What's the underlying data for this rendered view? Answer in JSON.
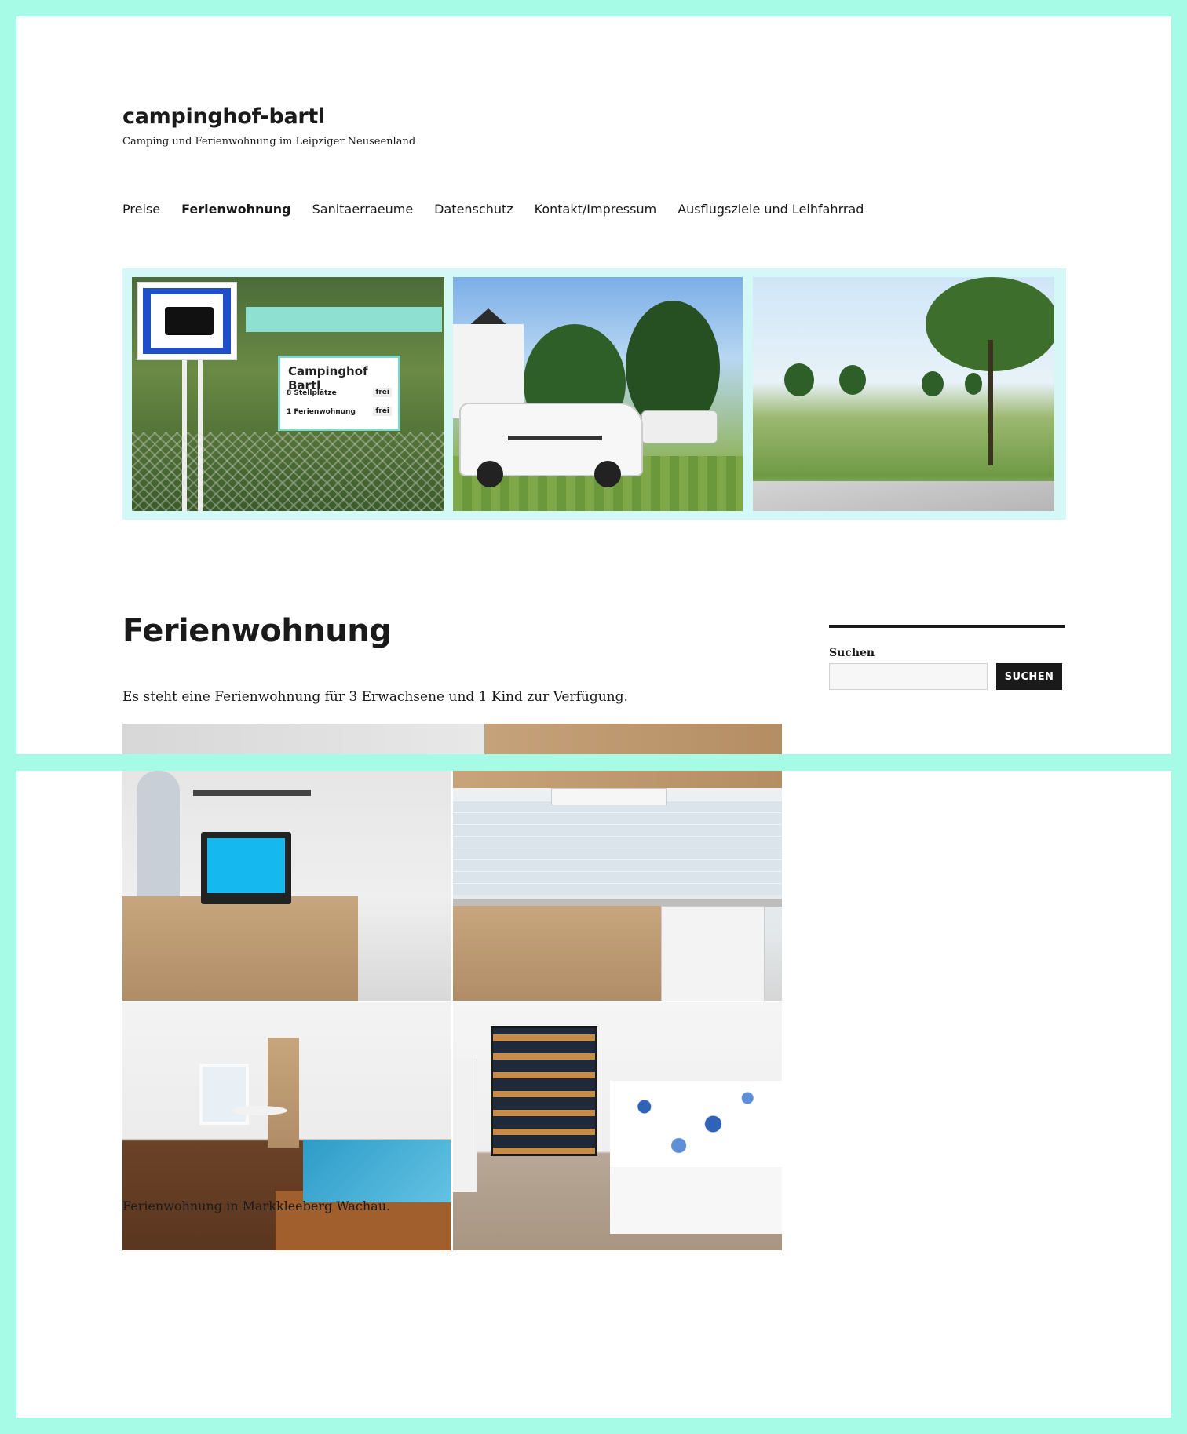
{
  "site": {
    "title": "campinghof-bartl",
    "description": "Camping und Ferienwohnung im Leipziger Neuseenland"
  },
  "nav": {
    "items": [
      {
        "label": "Preise",
        "active": false
      },
      {
        "label": "Ferienwohnung",
        "active": true
      },
      {
        "label": "Sanitaerraeume",
        "active": false
      },
      {
        "label": "Datenschutz",
        "active": false
      },
      {
        "label": "Kontakt/Impressum",
        "active": false
      },
      {
        "label": "Ausflugsziele und Leihfahrrad",
        "active": false
      }
    ]
  },
  "header_sign": {
    "title": "Campinghof Bartl",
    "rows": [
      {
        "label": "8 Stellplätze",
        "badge": "frei"
      },
      {
        "label": "1 Ferienwohnung",
        "badge": "frei"
      }
    ]
  },
  "page": {
    "title": "Ferienwohnung",
    "intro": "Es steht eine Ferienwohnung für 3 Erwachsene und 1 Kind zur Verfügung.",
    "caption": "Ferienwohnung in Markkleeberg Wachau."
  },
  "sidebar": {
    "search_label": "Suchen",
    "search_value": "",
    "search_button": "SUCHEN"
  },
  "colors": {
    "frame": "#a5fbe6",
    "header_bg": "#d4f8f6",
    "text": "#1a1a1a"
  }
}
